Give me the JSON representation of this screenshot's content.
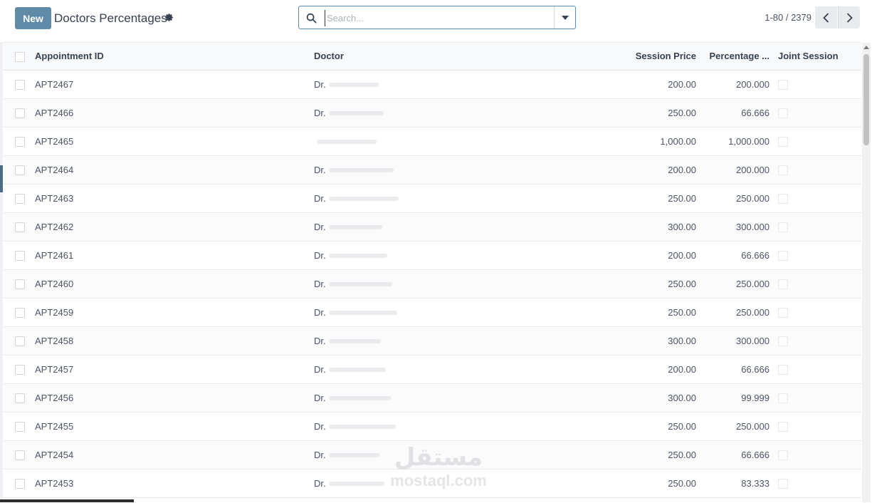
{
  "control_panel": {
    "new_label": "New",
    "title": "Doctors Percentages",
    "search_placeholder": "Search...",
    "pager_value": "1-80 / 2379"
  },
  "table": {
    "headers": {
      "appointment_id": "Appointment ID",
      "doctor": "Doctor",
      "session_price": "Session Price",
      "percentage": "Percentage ...",
      "joint_session": "Joint Session"
    },
    "rows": [
      {
        "id": "APT2467",
        "doctor": "Dr.",
        "price": "200.00",
        "pct": "200.000"
      },
      {
        "id": "APT2466",
        "doctor": "Dr.",
        "price": "250.00",
        "pct": "66.666"
      },
      {
        "id": "APT2465",
        "doctor": "",
        "price": "1,000.00",
        "pct": "1,000.000"
      },
      {
        "id": "APT2464",
        "doctor": "Dr.",
        "price": "200.00",
        "pct": "200.000"
      },
      {
        "id": "APT2463",
        "doctor": "Dr.",
        "price": "250.00",
        "pct": "250.000"
      },
      {
        "id": "APT2462",
        "doctor": "Dr.",
        "price": "300.00",
        "pct": "300.000"
      },
      {
        "id": "APT2461",
        "doctor": "Dr.",
        "price": "200.00",
        "pct": "66.666"
      },
      {
        "id": "APT2460",
        "doctor": "Dr.",
        "price": "250.00",
        "pct": "250.000"
      },
      {
        "id": "APT2459",
        "doctor": "Dr.",
        "price": "250.00",
        "pct": "250.000"
      },
      {
        "id": "APT2458",
        "doctor": "Dr.",
        "price": "300.00",
        "pct": "300.000"
      },
      {
        "id": "APT2457",
        "doctor": "Dr.",
        "price": "200.00",
        "pct": "66.666"
      },
      {
        "id": "APT2456",
        "doctor": "Dr.",
        "price": "300.00",
        "pct": "99.999"
      },
      {
        "id": "APT2455",
        "doctor": "Dr.",
        "price": "250.00",
        "pct": "250.000"
      },
      {
        "id": "APT2454",
        "doctor": "Dr.",
        "price": "250.00",
        "pct": "66.666"
      },
      {
        "id": "APT2453",
        "doctor": "Dr.",
        "price": "250.00",
        "pct": "83.333"
      }
    ]
  },
  "watermark": {
    "arabic": "مستقل",
    "latin": "mostaql.com"
  },
  "colors": {
    "primary": "#5f8ba9",
    "text": "#374151"
  },
  "icons": {
    "settings": "gear-icon",
    "search": "search-icon",
    "dropdown": "caret-down-icon",
    "prev": "chevron-left-icon",
    "next": "chevron-right-icon"
  }
}
